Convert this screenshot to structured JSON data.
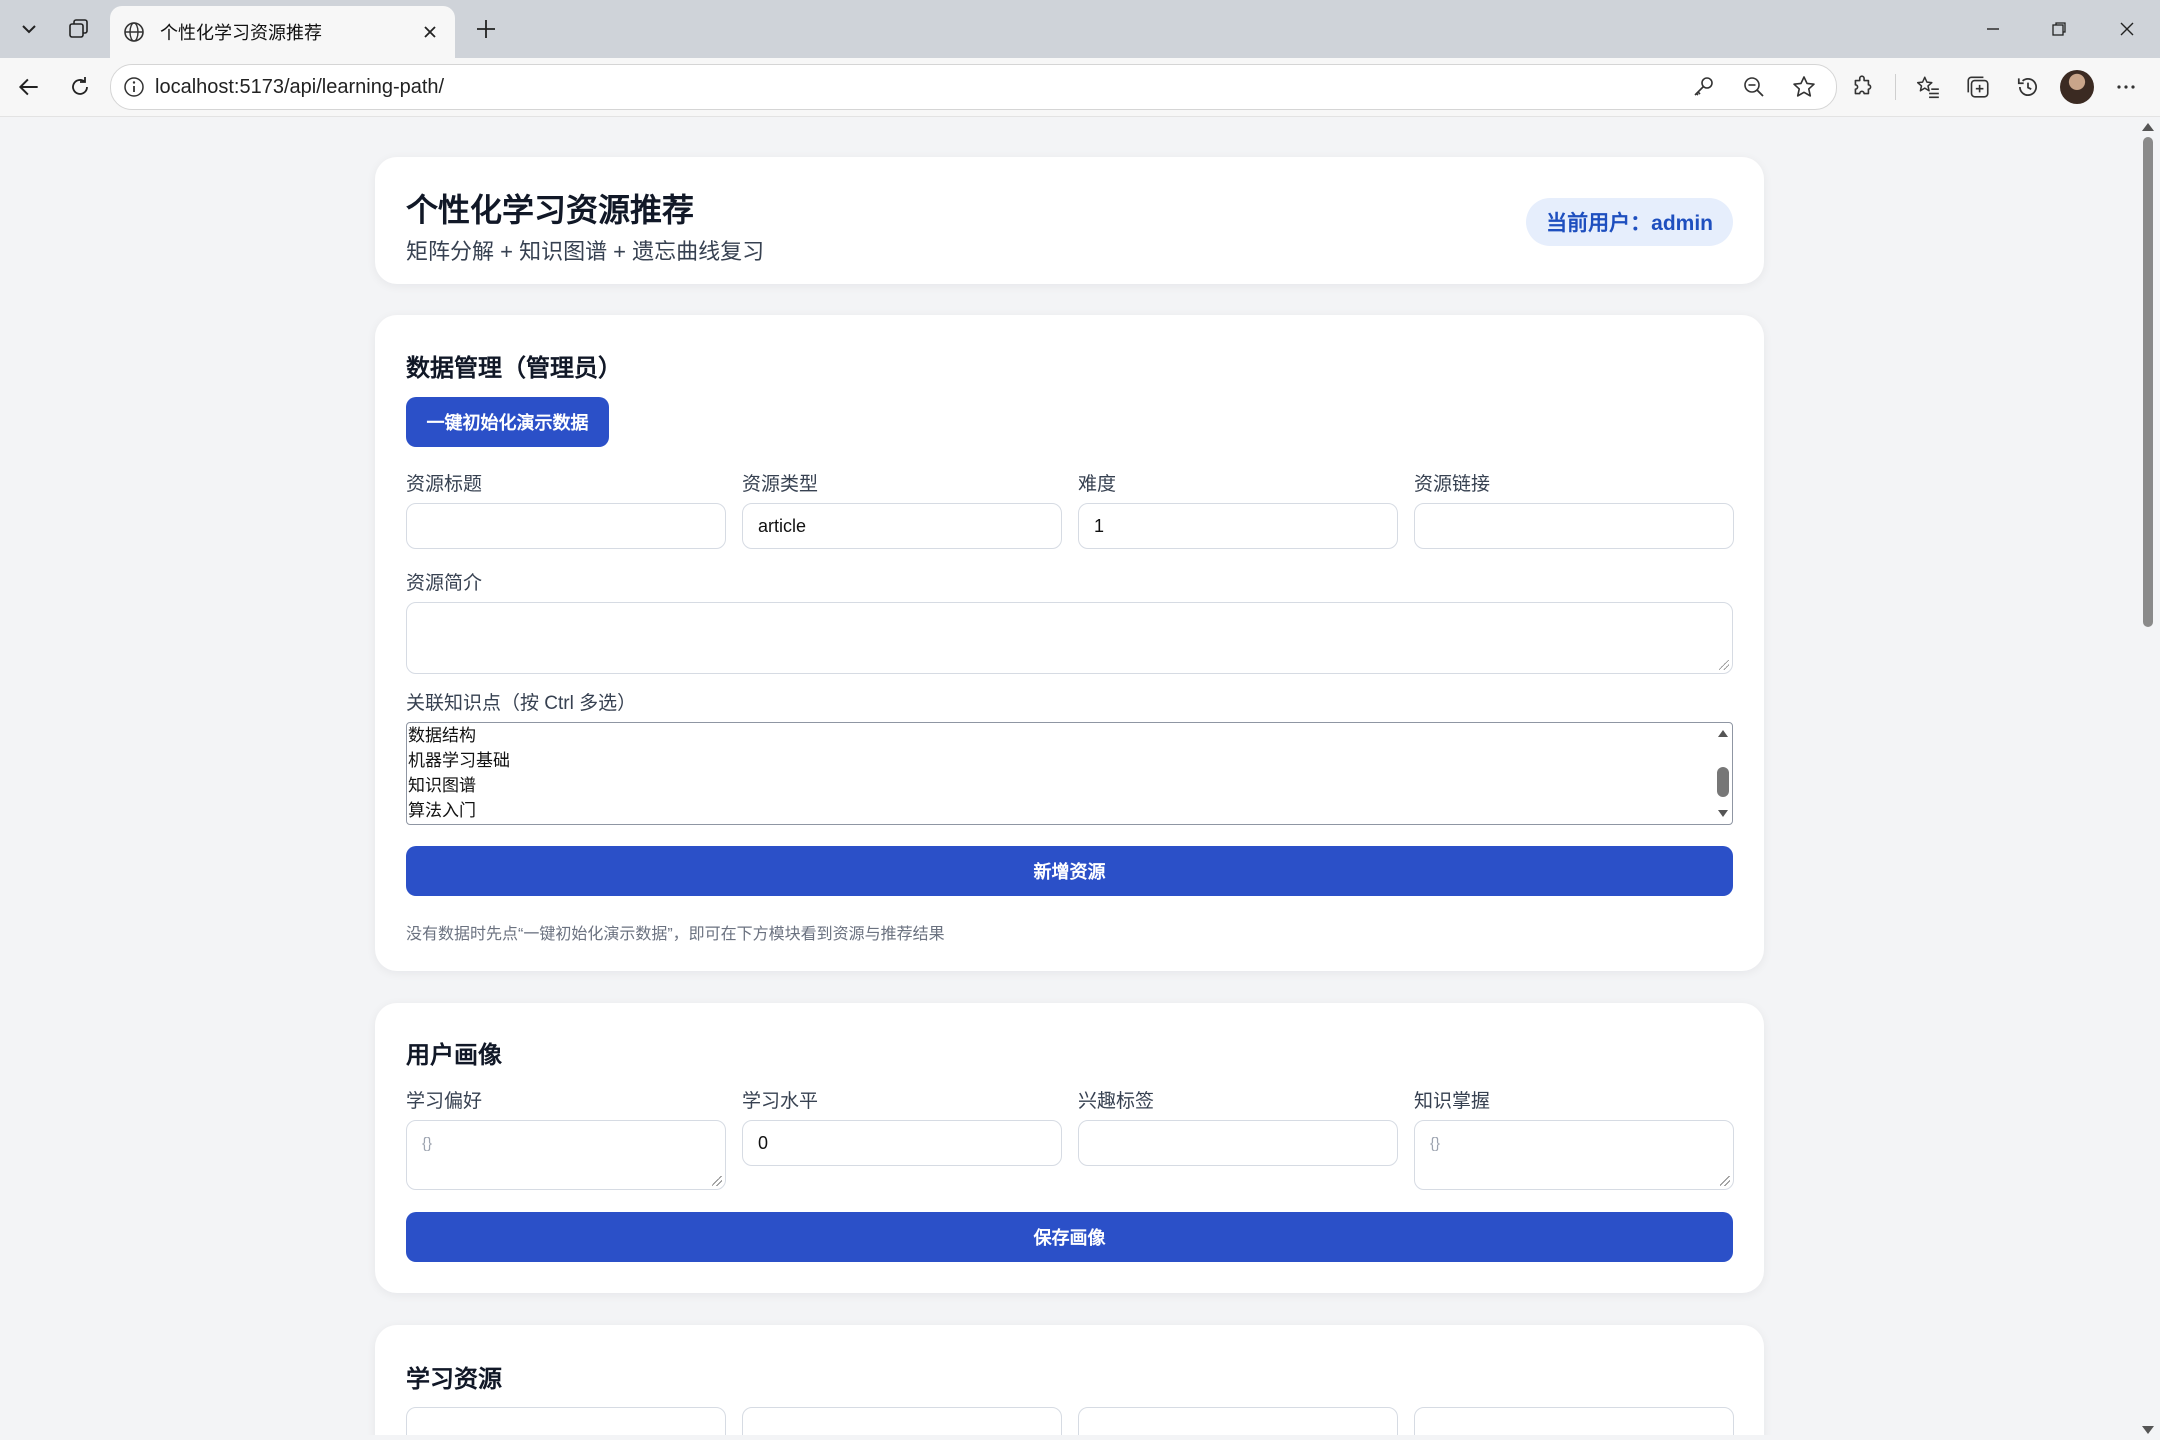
{
  "browser": {
    "tab_title": "个性化学习资源推荐",
    "url": "localhost:5173/api/learning-path/"
  },
  "header": {
    "title": "个性化学习资源推荐",
    "subtitle": "矩阵分解 + 知识图谱 + 遗忘曲线复习",
    "current_user": "当前用户：admin"
  },
  "data_mgmt": {
    "title": "数据管理（管理员）",
    "init_button": "一键初始化演示数据",
    "fields": {
      "title_label": "资源标题",
      "title_value": "",
      "type_label": "资源类型",
      "type_value": "article",
      "difficulty_label": "难度",
      "difficulty_value": "1",
      "link_label": "资源链接",
      "link_value": "",
      "desc_label": "资源简介",
      "desc_value": ""
    },
    "knowledge_label": "关联知识点（按 Ctrl 多选）",
    "knowledge_options": [
      "数据结构",
      "机器学习基础",
      "知识图谱",
      "算法入门"
    ],
    "add_button": "新增资源",
    "hint": "没有数据时先点“一键初始化演示数据”，即可在下方模块看到资源与推荐结果"
  },
  "profile": {
    "title": "用户画像",
    "pref_label": "学习偏好",
    "pref_placeholder": "{}",
    "level_label": "学习水平",
    "level_value": "0",
    "tags_label": "兴趣标签",
    "tags_value": "",
    "mastery_label": "知识掌握",
    "mastery_placeholder": "{}",
    "save_button": "保存画像"
  },
  "resources": {
    "title": "学习资源"
  },
  "colors": {
    "primary": "#2b50c8",
    "pill_bg": "#e6eefc",
    "pill_text": "#1e4fbf",
    "page_bg": "#f3f4f6"
  }
}
